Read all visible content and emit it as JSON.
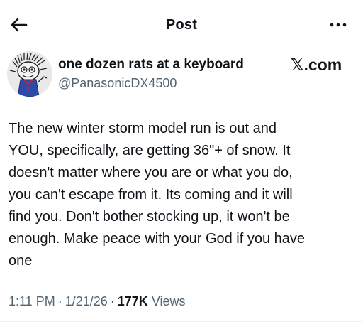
{
  "header": {
    "title": "Post",
    "back_icon": "back-arrow-icon",
    "more_icon": "more-options-icon"
  },
  "author": {
    "display_name": "one dozen rats at a keyboard",
    "handle": "@PanasonicDX4500",
    "avatar_icon": "avatar-cartoon-rat"
  },
  "source_badge": "𝕏.com",
  "tweet": {
    "lines": [
      "The new winter storm model run is out and",
      "YOU, specifically, are getting 36\"+ of snow. It",
      "doesn't matter where you are or what you do,",
      "you can't escape from it. Its coming and it will",
      "find you. Don't bother stocking up, it won't be",
      "enough. Make peace with your God if you have",
      "one"
    ]
  },
  "meta": {
    "time": "1:11 PM",
    "separator": "·",
    "date": "1/21/26",
    "views_count": "177K",
    "views_label": "Views"
  },
  "colors": {
    "text": "#0f1419",
    "secondary_text": "#536471",
    "background": "#ffffff"
  }
}
